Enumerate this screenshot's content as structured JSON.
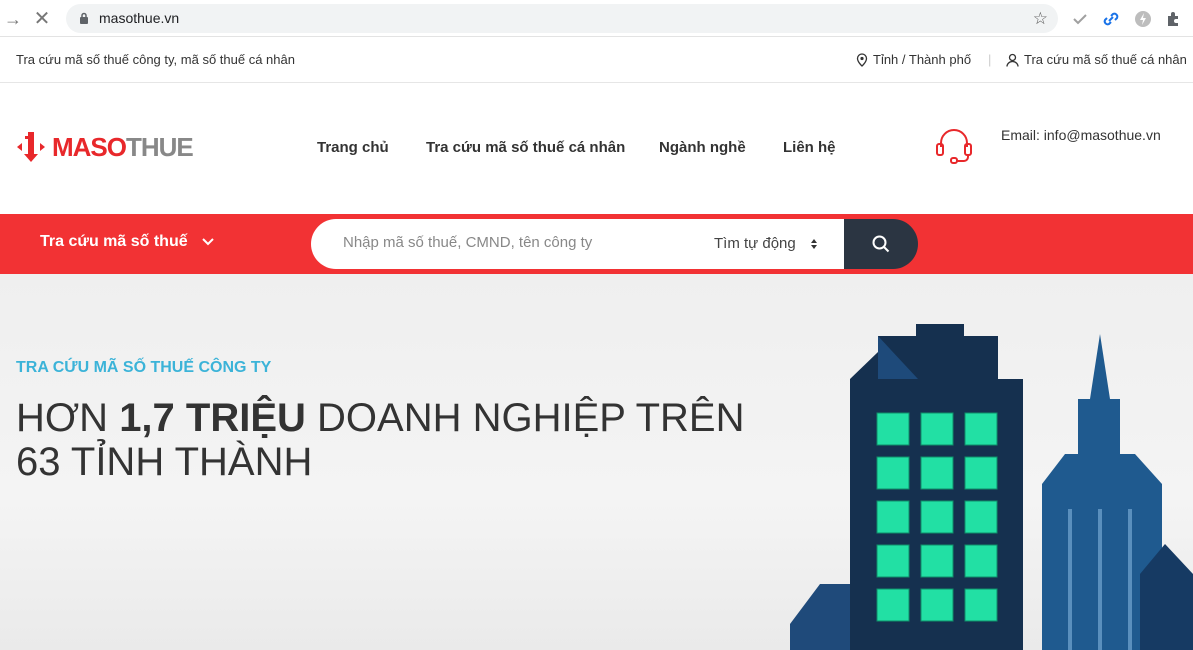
{
  "browser": {
    "url": "masothue.vn"
  },
  "topbar": {
    "tagline": "Tra cứu mã số thuế công ty, mã số thuế cá nhân",
    "province_label": "Tỉnh / Thành phố",
    "personal_label": "Tra cứu mã số thuế cá nhân"
  },
  "header": {
    "logo_maso": "MASO",
    "logo_thue": "THUE",
    "nav": [
      "Trang chủ",
      "Tra cứu mã số thuế cá nhân",
      "Ngành nghề",
      "Liên hệ"
    ],
    "email": "Email: info@masothue.vn"
  },
  "search": {
    "type_label": "Tra cứu mã số thuế",
    "placeholder": "Nhập mã số thuế, CMND, tên công ty",
    "mode_label": "Tìm tự động"
  },
  "hero": {
    "subtitle": "TRA CỨU MÃ SỐ THUẾ CÔNG TY",
    "title_prefix": "HƠN ",
    "title_bold": "1,7 TRIỆU",
    "title_suffix": " DOANH NGHIỆP TRÊN",
    "title_line2": "63 TỈNH THÀNH"
  },
  "colors": {
    "brand_red": "#f23234",
    "accent_blue": "#3bb3d8",
    "dark_navy": "#2b3542"
  }
}
